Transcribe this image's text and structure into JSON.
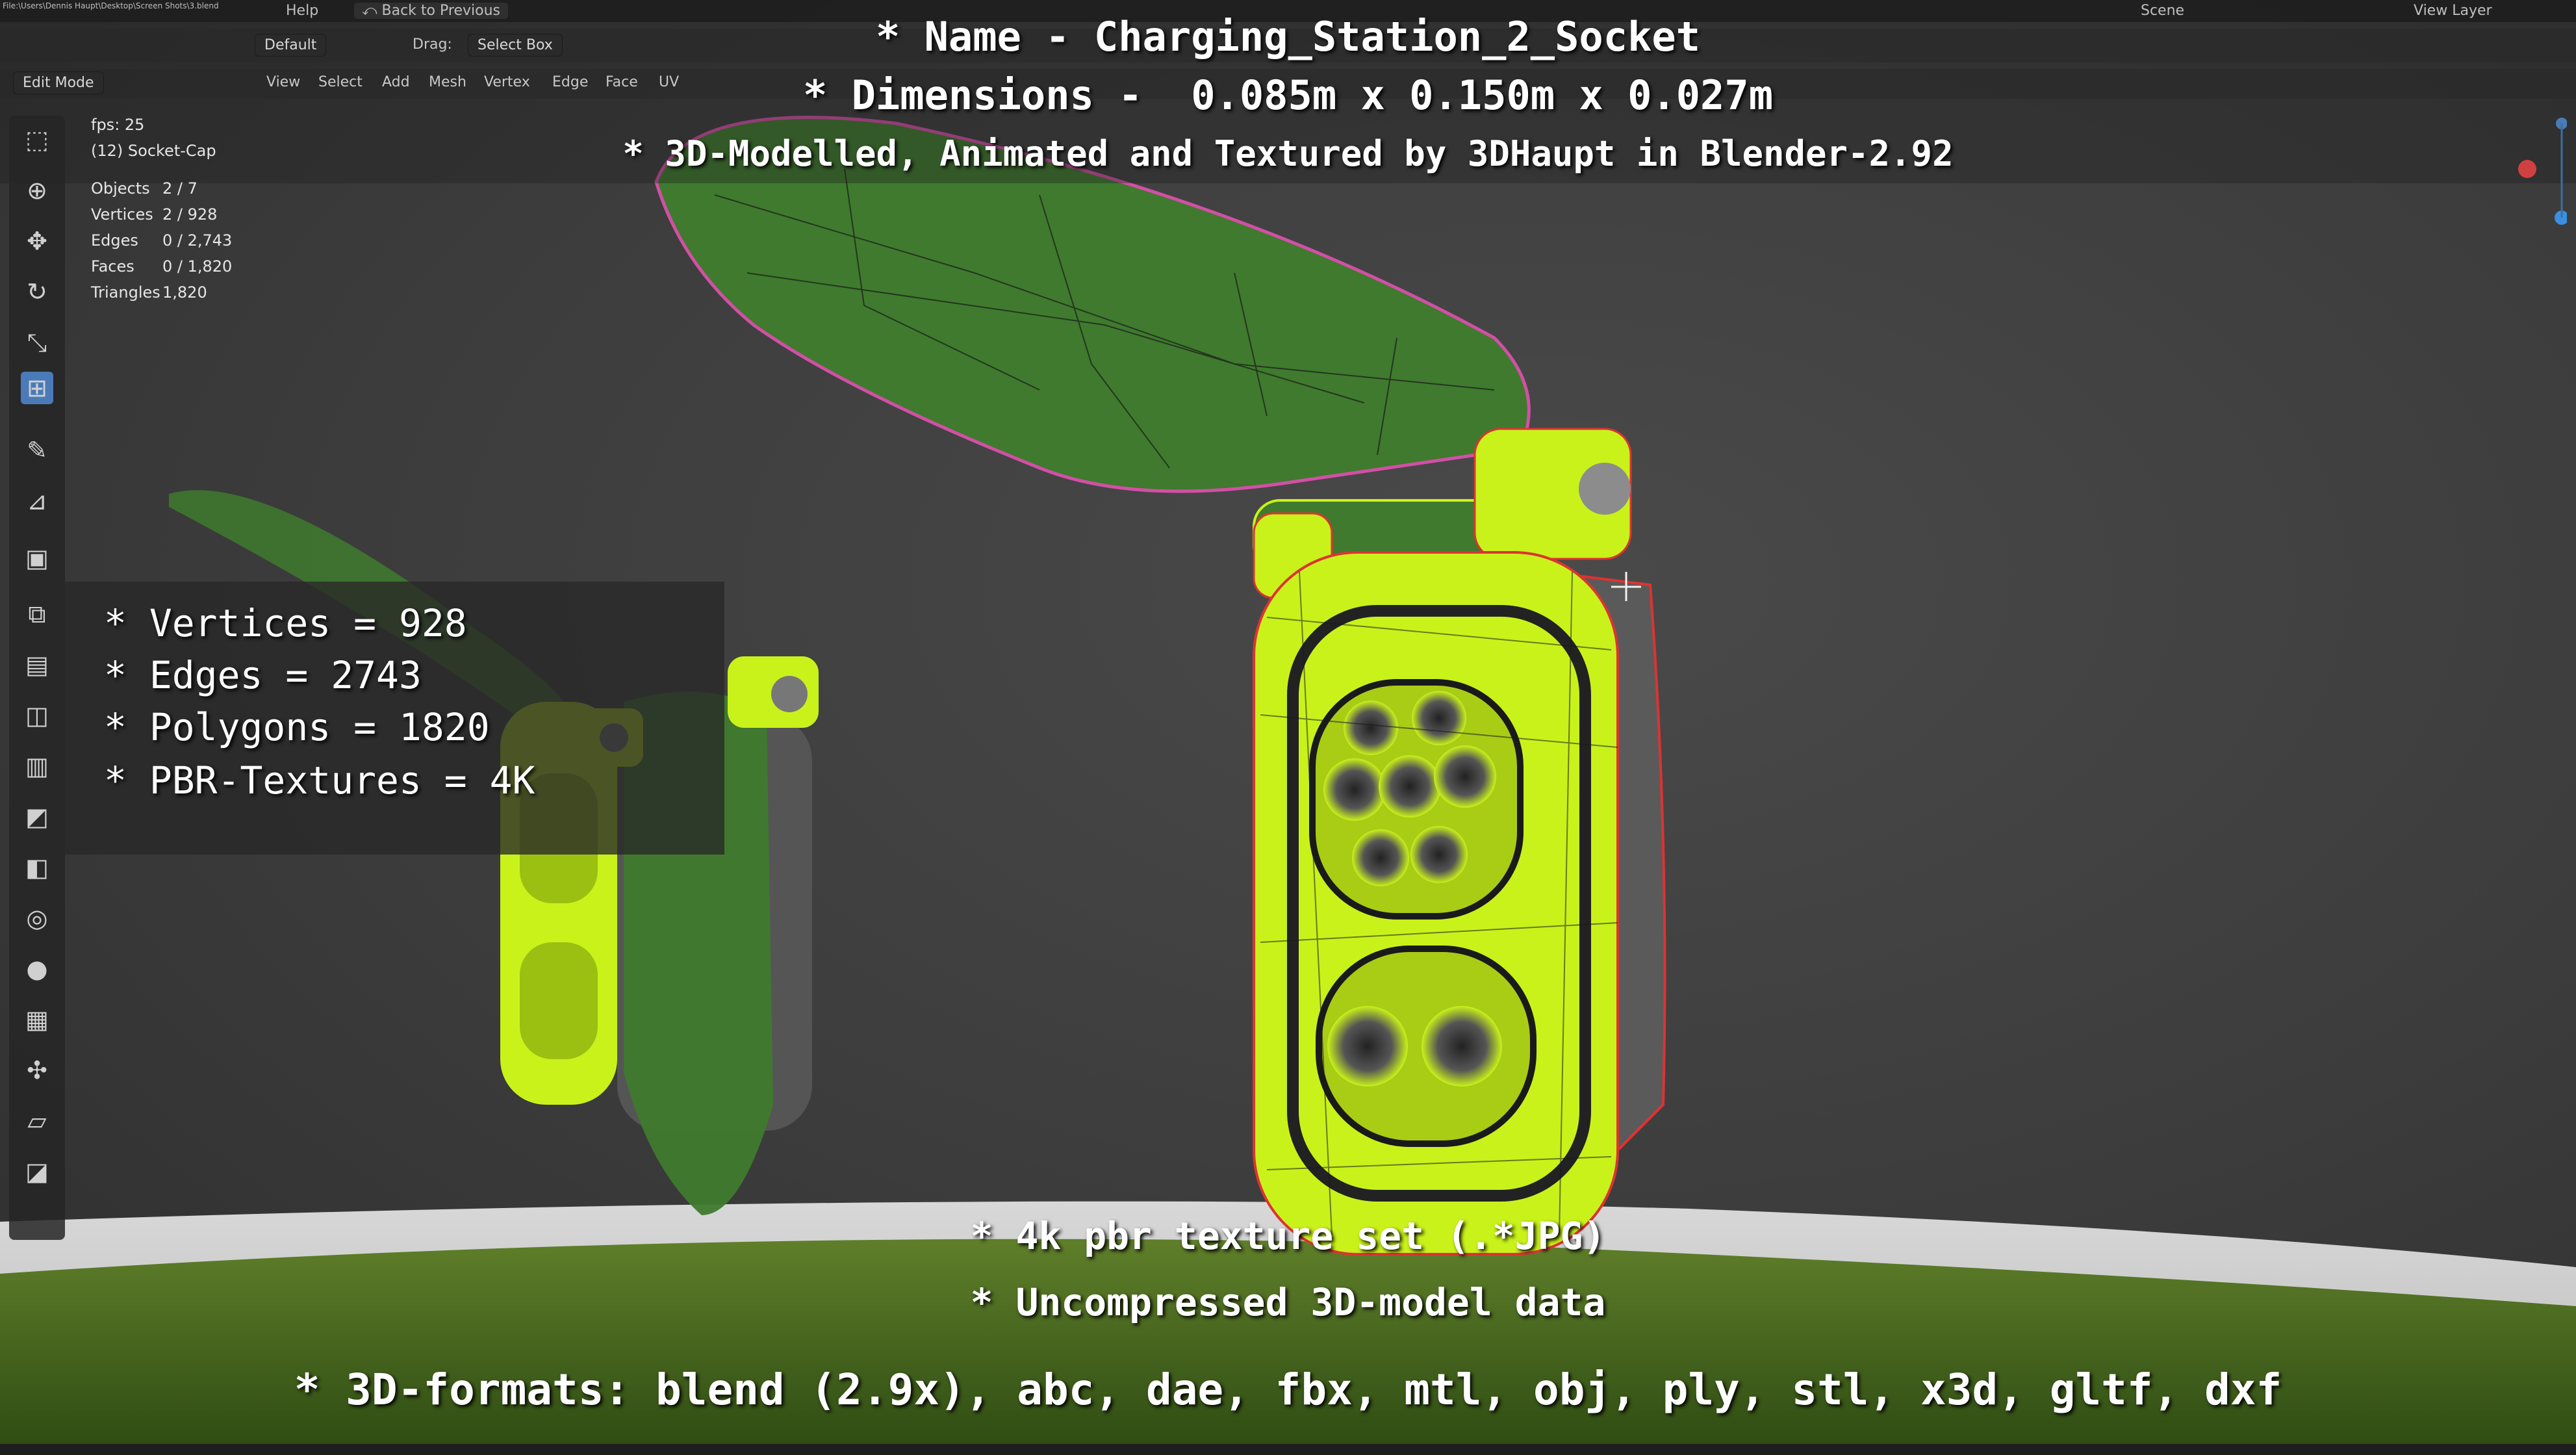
{
  "app": {
    "file_path": "File:\\Users\\Dennis Haupt\\Desktop\\Screen Shots\\3.blend",
    "top_menu": [
      "Help"
    ],
    "back_button": "Back to Previous",
    "scene": "Scene",
    "view_layer": "View Layer"
  },
  "header": {
    "orientation_label": "Default",
    "drag_label": "Drag:",
    "drag_value": "Select Box",
    "mode": "Edit Mode",
    "menus": [
      "View",
      "Select",
      "Add",
      "Mesh",
      "Vertex",
      "Edge",
      "Face",
      "UV"
    ]
  },
  "overlay": {
    "fps": "fps: 25",
    "object_name": "(12) Socket-Cap",
    "stats": [
      {
        "key": "Objects",
        "value": "2 / 7"
      },
      {
        "key": "Vertices",
        "value": "2 / 928"
      },
      {
        "key": "Edges",
        "value": "0 / 2,743"
      },
      {
        "key": "Faces",
        "value": "0 / 1,820"
      },
      {
        "key": "Triangles",
        "value": "1,820"
      }
    ]
  },
  "captions": {
    "name": "* Name - Charging_Station_2_Socket",
    "dimensions": "* Dimensions -  0.085m x 0.150m x 0.027m",
    "credits": "* 3D-Modelled, Animated and Textured by 3DHaupt in Blender-2.92",
    "specs": [
      "* Vertices = 928",
      "* Edges = 2743",
      "* Polygons = 1820",
      "* PBR-Textures = 4K"
    ],
    "texture_set": "* 4k pbr texture set (.*JPG)",
    "uncompressed": "* Uncompressed 3D-model data",
    "formats": "* 3D-formats: blend (2.9x), abc, dae, fbx, mtl, obj, ply, stl, x3d, gltf, dxf"
  },
  "icons": {
    "tools": [
      "select-box-icon",
      "cursor-icon",
      "move-icon",
      "rotate-icon",
      "scale-icon",
      "transform-icon",
      "annotate-icon",
      "measure-icon",
      "add-cube-icon",
      "extrude-icon",
      "inset-icon",
      "bevel-icon",
      "loop-cut-icon",
      "knife-icon",
      "poly-build-icon",
      "spin-icon",
      "smooth-icon",
      "edge-slide-icon",
      "shrink-icon",
      "shear-icon",
      "rip-icon"
    ]
  },
  "colors": {
    "accent": "#4a7bb8",
    "mesh_yellow": "#c9f21a",
    "mesh_green": "#3f7a2e",
    "background": "#3c3c3c"
  }
}
